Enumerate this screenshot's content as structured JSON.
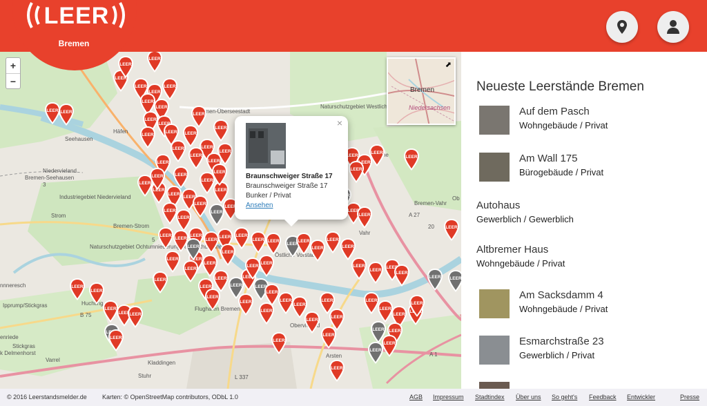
{
  "header": {
    "logo": "LEER",
    "city": "Bremen",
    "location_button_icon": "map-pin-icon",
    "user_button_icon": "user-icon",
    "brand_color": "#e8412c"
  },
  "map": {
    "zoom_in": "+",
    "zoom_out": "−",
    "marker_label": "LEER",
    "labels": [
      "Seehausen",
      "Häfen",
      "Niedervieland",
      "Bremen-Seehausen",
      "Industriegebiet Niedervieland",
      "Strom",
      "Bremen-Strom",
      "Naturschutzgebiet Ochtumniederung bei Brokhuchting",
      "Ipprump/Stickgras",
      "nnneresch",
      "Huchting",
      "Kladdingen",
      "Varrel",
      "Stuhr",
      "Obervieland",
      "Arsten",
      "Flughafen Bremen",
      "Östliche Vorstadt",
      "Bremen-Überseestadt",
      "Naturschutzgebiet Westliches Hollerland",
      "Lehe",
      "Bremen-Vahr",
      "Vahr",
      "Ob",
      "A 27",
      "A 1",
      "B 75",
      "L 337",
      "20",
      "5",
      "3",
      "enriede",
      "Stickgras",
      "k Delmenhorst"
    ],
    "minimap": {
      "city": "Bremen",
      "region": "Niedersachsen",
      "expand_icon": "expand-icon"
    }
  },
  "popup": {
    "title": "Braunschweiger Straße 17",
    "address": "Braunschweiger Straße 17",
    "type": "Bunker / Privat",
    "link": "Ansehen",
    "close": "×"
  },
  "sidebar": {
    "title": "Neueste Leerstände Bremen",
    "entries": [
      {
        "name": "Auf dem Pasch",
        "type": "Wohngebäude / Privat"
      },
      {
        "name": "Am Wall 175",
        "type": "Bürogebäude / Privat"
      },
      {
        "name": "Autohaus",
        "type": "Gewerblich / Gewerblich"
      },
      {
        "name": "Altbremer Haus",
        "type": "Wohngebäude / Privat"
      },
      {
        "name": "Am Sacksdamm 4",
        "type": "Wohngebäude / Privat"
      },
      {
        "name": "Esmarchstraße 23",
        "type": "Gewerblich / Privat"
      }
    ]
  },
  "footer": {
    "copyright": "© 2016 Leerstandsmelder.de",
    "maps_credit": "Karten: © OpenStreetMap contributors, ODbL 1.0",
    "links": [
      "AGB",
      "Impressum",
      "Stadtindex",
      "Über uns",
      "So geht's",
      "Feedback",
      "Entwickler",
      "Presse"
    ]
  }
}
